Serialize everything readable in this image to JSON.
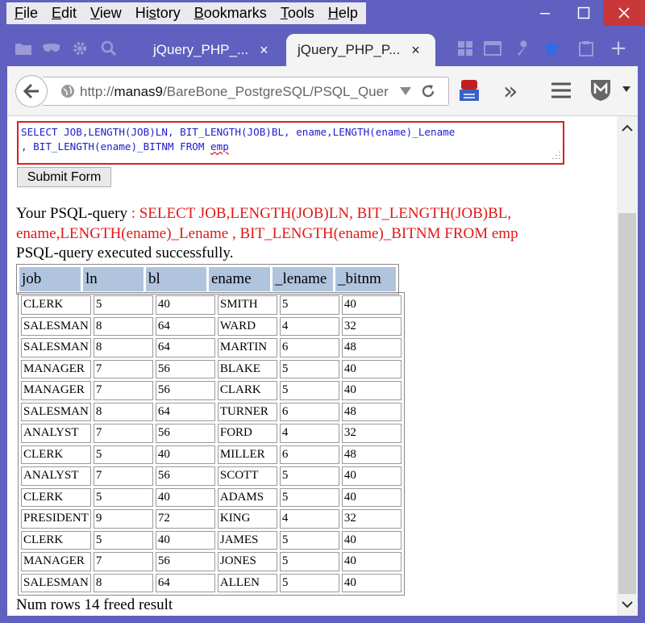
{
  "menu": [
    "File",
    "Edit",
    "View",
    "History",
    "Bookmarks",
    "Tools",
    "Help"
  ],
  "menu_underline": [
    "F",
    "E",
    "V",
    "s",
    "B",
    "T",
    "H"
  ],
  "tabs": [
    {
      "label": "jQuery_PHP_...",
      "close": "×"
    },
    {
      "label": "jQuery_PHP_P...",
      "close": "×"
    }
  ],
  "new_tab": "+",
  "url": {
    "prefix": "http://",
    "host": "manas9",
    "path": "/BareBone_PostgreSQL/PSQL_Quer"
  },
  "overflow_chevrons": "»",
  "query": {
    "line1": "SELECT JOB,LENGTH(JOB)LN, BIT_LENGTH(JOB)BL, ename,LENGTH(ename)_Lename",
    "line2_a": ", BIT_LENGTH(ename)_BITNM FROM ",
    "line2_b": "emp"
  },
  "submit_label": "Submit Form",
  "result": {
    "your_query_label": "Your PSQL-query",
    "query_line1": " : SELECT JOB,LENGTH(JOB)LN, BIT_LENGTH(JOB)BL,",
    "query_line2": "ename,LENGTH(ename)_Lename , BIT_LENGTH(ename)_BITNM FROM emp",
    "status": "PSQL-query executed successfully.",
    "footer": "Num rows 14 freed result"
  },
  "table": {
    "headers": [
      "job",
      "ln",
      "bl",
      "ename",
      "_lename",
      "_bitnm"
    ],
    "rows": [
      [
        "CLERK",
        "5",
        "40",
        "SMITH",
        "5",
        "40"
      ],
      [
        "SALESMAN",
        "8",
        "64",
        "WARD",
        "4",
        "32"
      ],
      [
        "SALESMAN",
        "8",
        "64",
        "MARTIN",
        "6",
        "48"
      ],
      [
        "MANAGER",
        "7",
        "56",
        "BLAKE",
        "5",
        "40"
      ],
      [
        "MANAGER",
        "7",
        "56",
        "CLARK",
        "5",
        "40"
      ],
      [
        "SALESMAN",
        "8",
        "64",
        "TURNER",
        "6",
        "48"
      ],
      [
        "ANALYST",
        "7",
        "56",
        "FORD",
        "4",
        "32"
      ],
      [
        "CLERK",
        "5",
        "40",
        "MILLER",
        "6",
        "48"
      ],
      [
        "ANALYST",
        "7",
        "56",
        "SCOTT",
        "5",
        "40"
      ],
      [
        "CLERK",
        "5",
        "40",
        "ADAMS",
        "5",
        "40"
      ],
      [
        "PRESIDENT",
        "9",
        "72",
        "KING",
        "4",
        "32"
      ],
      [
        "CLERK",
        "5",
        "40",
        "JAMES",
        "5",
        "40"
      ],
      [
        "MANAGER",
        "7",
        "56",
        "JONES",
        "5",
        "40"
      ],
      [
        "SALESMAN",
        "8",
        "64",
        "ALLEN",
        "5",
        "40"
      ]
    ]
  },
  "colors": {
    "frame": "#6060c0",
    "query_text": "#1c1ccc",
    "error_red": "#e01818",
    "header_bg": "#b0c4de",
    "close_btn": "#c8383a"
  }
}
